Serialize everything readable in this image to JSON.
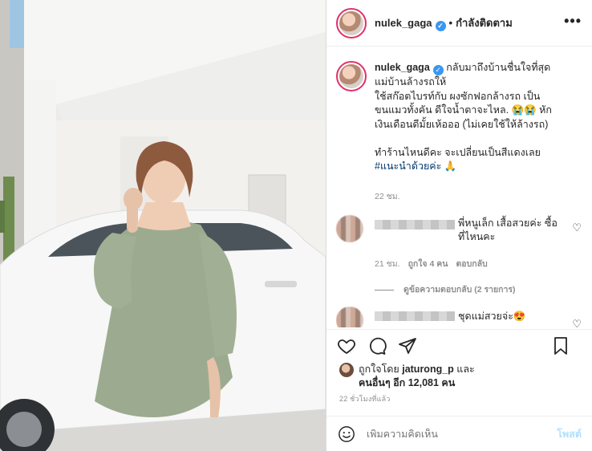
{
  "post": {
    "username": "nulek_gaga",
    "follow_status": "กำลังติดตาม",
    "more": "•••",
    "caption_lines": [
      "กลับมาถึงบ้านชื่นใจที่สุด",
      "แม่บ้านล้างรถให้",
      "ใช้สก๊อตไบรท์กับ ผงซักฟอกล้างรถ เป็น",
      "ขนแมวทั้งคัน ดีใจน้ำตาจะไหล. 😭😭 หัก",
      "เงินเดือนดีมั้ยเห้อออ (ไม่เคยใช้ให้ล้างรถ)",
      "",
      "ทำร้านไหนดีคะ จะเปลี่ยนเป็นสีแดงเลย"
    ],
    "caption_hashtag": "#แนะนำด้วยค่ะ",
    "caption_hashtag_emoji": "🙏",
    "caption_time": "22 ชม."
  },
  "comments": [
    {
      "text": "พี่หนูเล็ก เสื้อสวยค่ะ ซื้อที่ไหนคะ",
      "time": "21 ชม.",
      "likes": "ถูกใจ 4 คน",
      "reply": "ตอบกลับ"
    },
    {
      "text": "ชุดแม่สวยจ่ะ😍",
      "time": "",
      "likes": "",
      "reply": ""
    }
  ],
  "view_replies": "ดูข้อความตอบกลับ (2 รายการ)",
  "likes": {
    "prefix": "ถูกใจโดย",
    "user": "jaturong_p",
    "and": "และ",
    "others": "คนอื่นๆ อีก 12,081 คน"
  },
  "post_date": "22 ชั่วโมงที่แล้ว",
  "comment_box": {
    "placeholder": "เพิ่มความคิดเห็น",
    "post_label": "โพสต์"
  },
  "icons": {
    "heart": "heart-icon",
    "comment": "comment-icon",
    "share": "share-icon",
    "save": "bookmark-icon",
    "emoji": "emoji-icon"
  },
  "colors": {
    "link": "#00376b",
    "verified": "#3897f0",
    "muted": "#8e8e8e",
    "post_button": "#b2dffc"
  }
}
